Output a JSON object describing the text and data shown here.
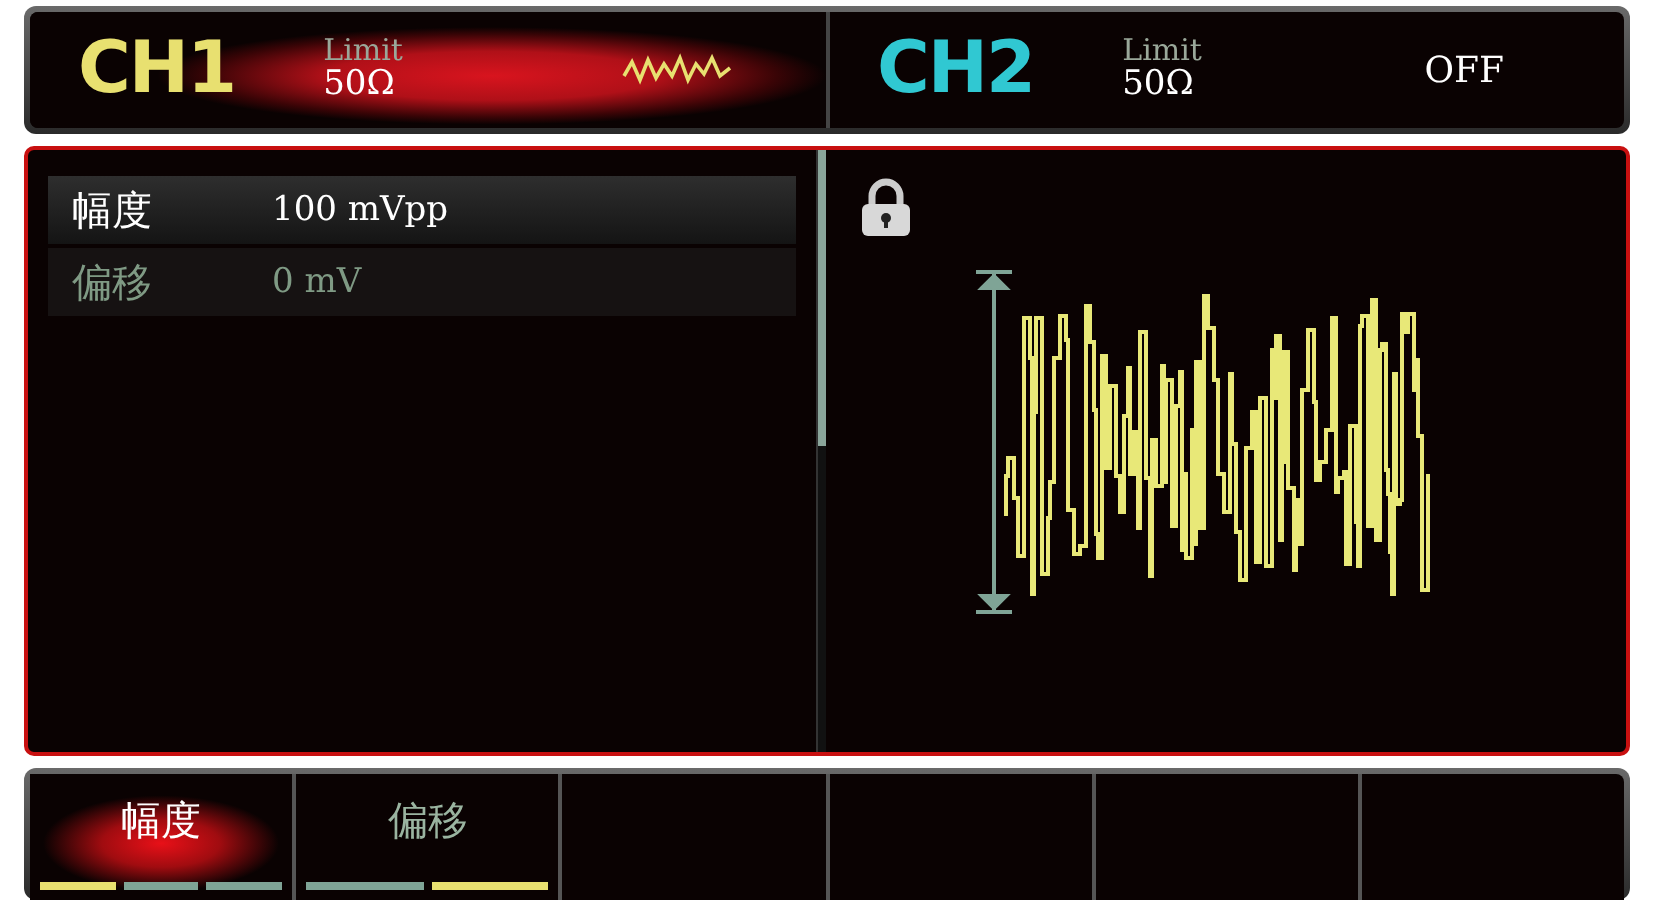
{
  "channels": [
    {
      "name": "CH1",
      "active": true,
      "color": "#e8e070",
      "limit_label": "Limit",
      "impedance": "50Ω",
      "output_on": true
    },
    {
      "name": "CH2",
      "active": false,
      "color": "#30c8d2",
      "limit_label": "Limit",
      "impedance": "50Ω",
      "output_on": false,
      "status": "OFF"
    }
  ],
  "params": [
    {
      "label": "幅度",
      "value": "100 mVpp",
      "selected": true
    },
    {
      "label": "偏移",
      "value": "0 mV",
      "selected": false
    }
  ],
  "waveform": {
    "locked": true
  },
  "softkeys": [
    {
      "label": "幅度",
      "selected": true,
      "segments": [
        {
          "active": true
        },
        {
          "active": false
        },
        {
          "active": false
        }
      ]
    },
    {
      "label": "偏移",
      "selected": false,
      "segments": [
        {
          "active": false
        },
        {
          "active": true
        }
      ]
    }
  ]
}
